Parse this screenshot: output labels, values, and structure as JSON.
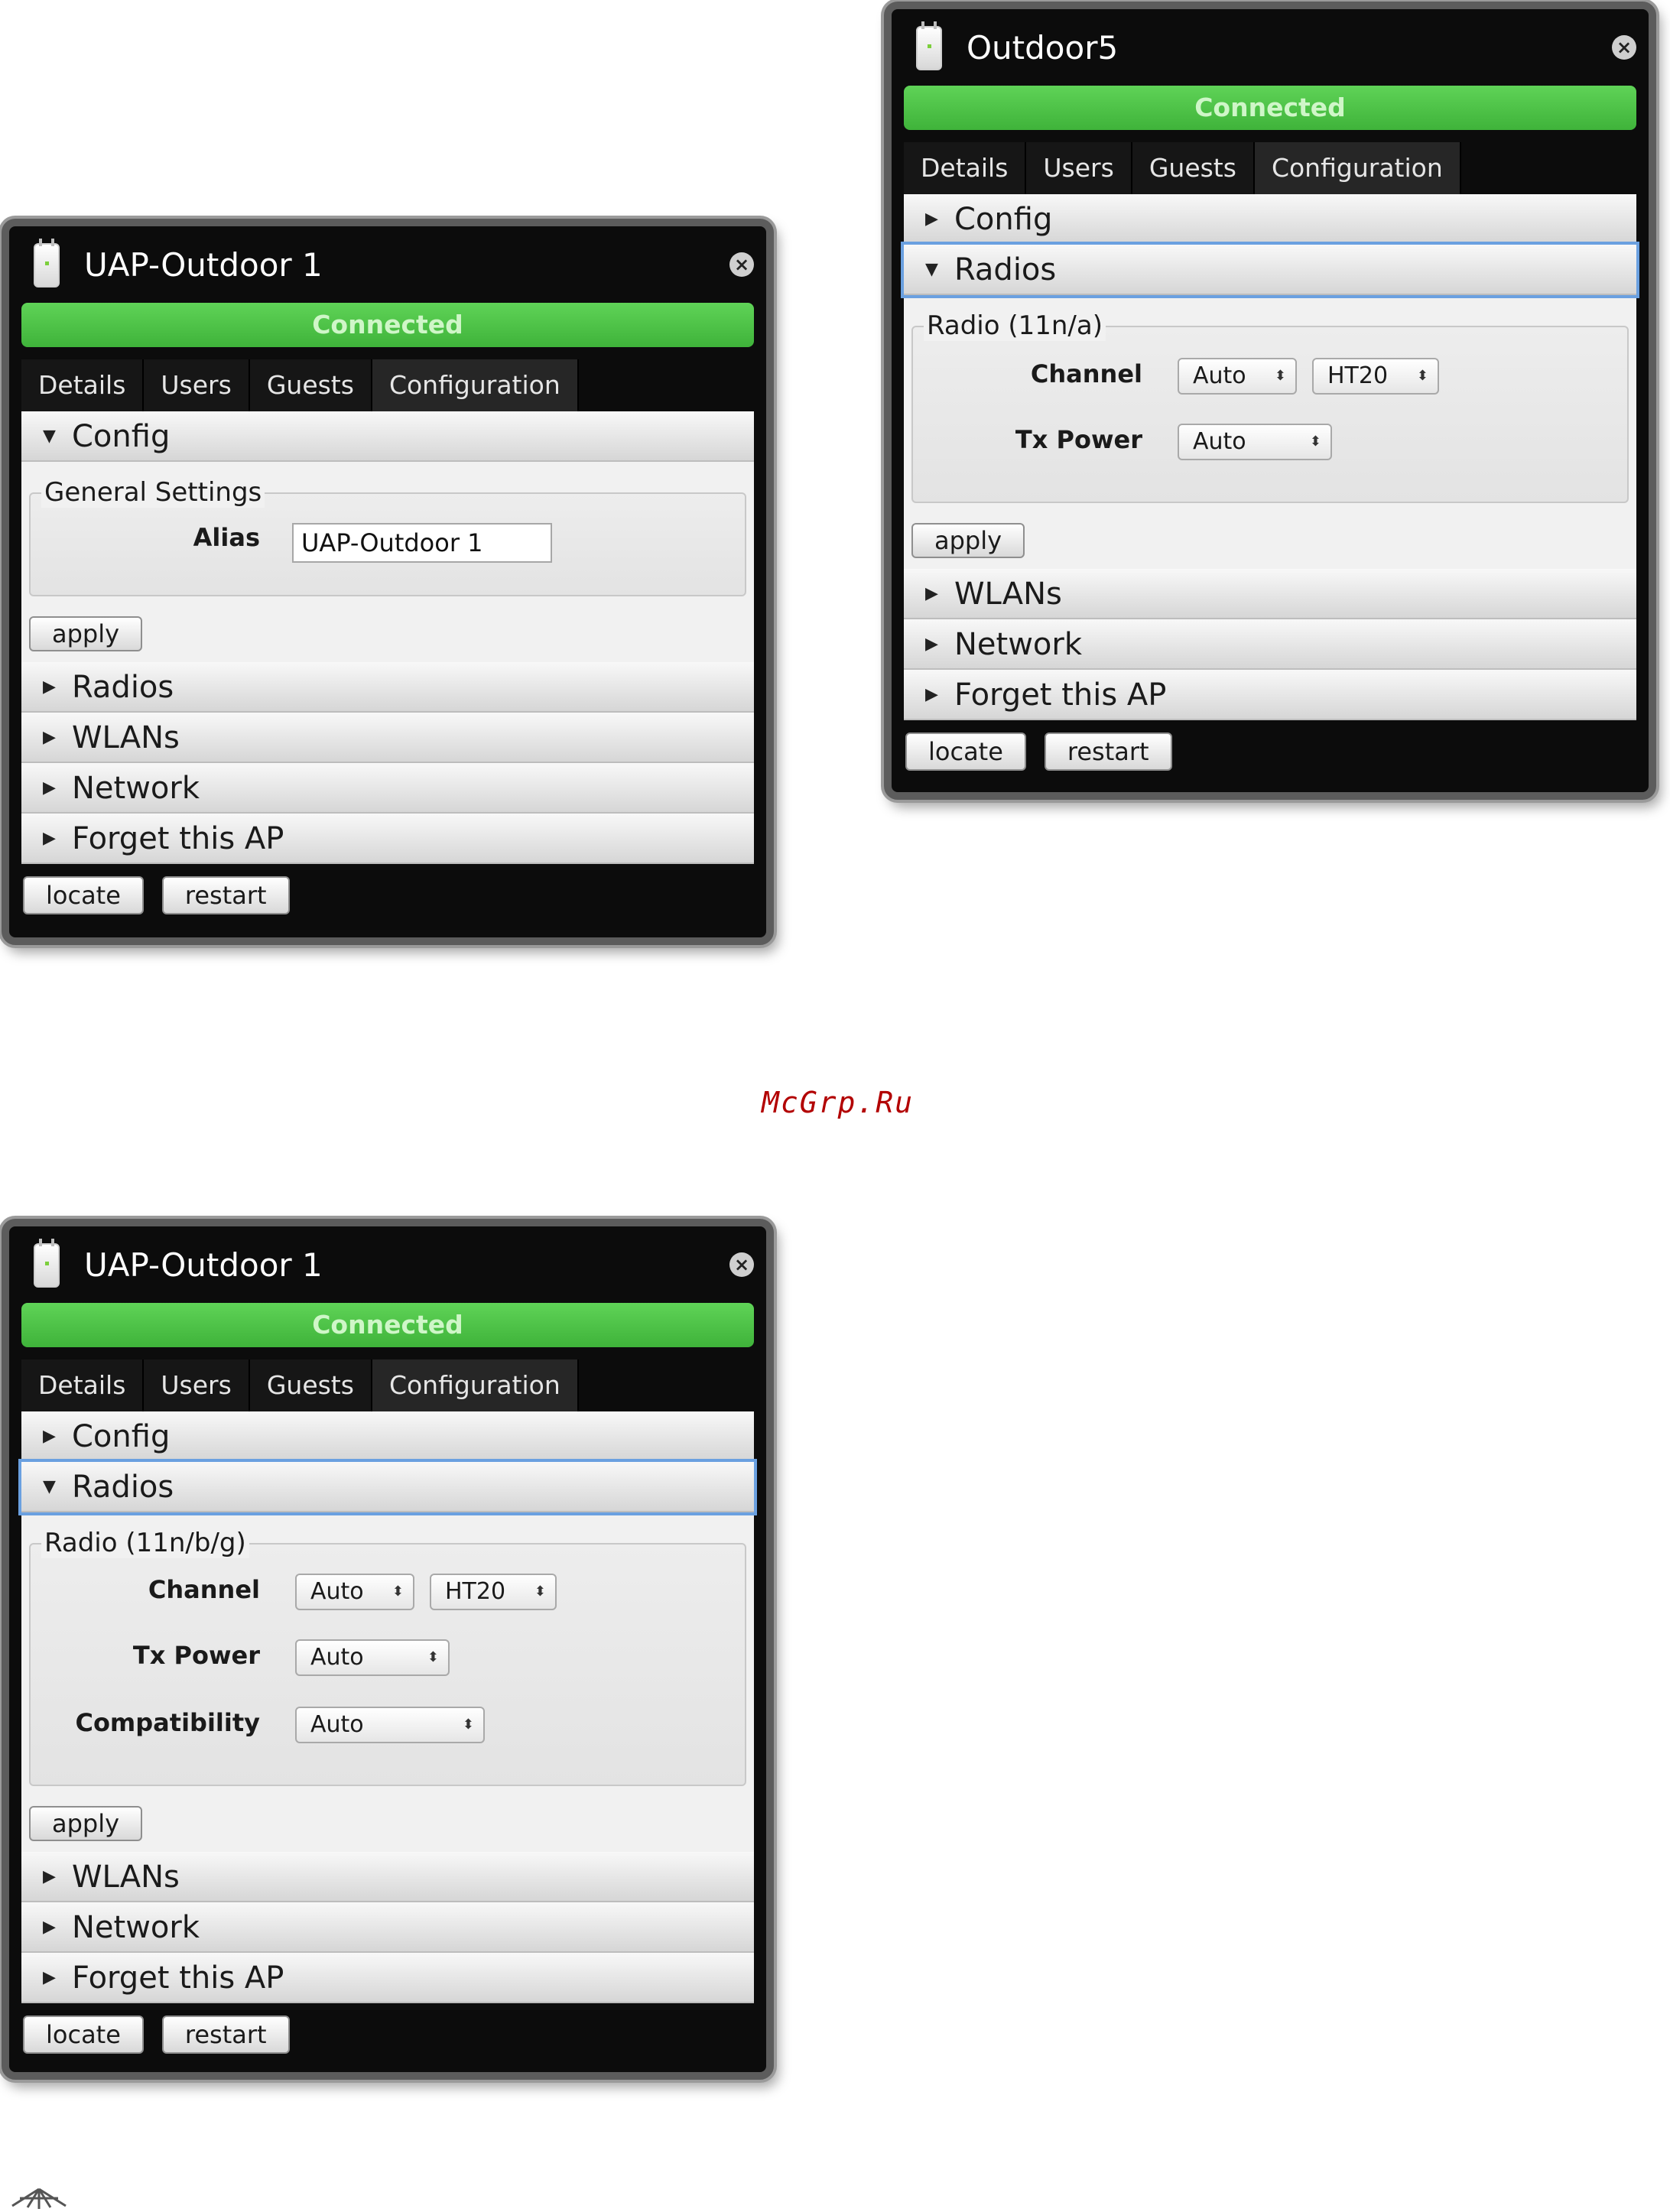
{
  "panels": [
    {
      "title": "UAP-Outdoor 1",
      "status": "Connected",
      "tabs": [
        "Details",
        "Users",
        "Guests",
        "Configuration"
      ],
      "config_section": {
        "label": "Config",
        "group_legend": "General Settings",
        "alias_label": "Alias",
        "alias_value": "UAP-Outdoor 1",
        "apply_label": "apply"
      },
      "collapsed_sections": [
        "Radios",
        "WLANs",
        "Network",
        "Forget this AP"
      ],
      "footer": {
        "locate": "locate",
        "restart": "restart"
      }
    },
    {
      "title": "Outdoor5",
      "status": "Connected",
      "tabs": [
        "Details",
        "Users",
        "Guests",
        "Configuration"
      ],
      "collapsed_top": "Config",
      "radios_section": {
        "label": "Radios",
        "group_legend": "Radio (11n/a)",
        "channel_label": "Channel",
        "channel_value": "Auto",
        "ht_value": "HT20",
        "txpower_label": "Tx Power",
        "txpower_value": "Auto",
        "apply_label": "apply"
      },
      "collapsed_sections": [
        "WLANs",
        "Network",
        "Forget this AP"
      ],
      "footer": {
        "locate": "locate",
        "restart": "restart"
      }
    },
    {
      "title": "UAP-Outdoor 1",
      "status": "Connected",
      "tabs": [
        "Details",
        "Users",
        "Guests",
        "Configuration"
      ],
      "collapsed_top": "Config",
      "radios_section": {
        "label": "Radios",
        "group_legend": "Radio (11n/b/g)",
        "channel_label": "Channel",
        "channel_value": "Auto",
        "ht_value": "HT20",
        "txpower_label": "Tx Power",
        "txpower_value": "Auto",
        "compat_label": "Compatibility",
        "compat_value": "Auto",
        "apply_label": "apply"
      },
      "collapsed_sections": [
        "WLANs",
        "Network",
        "Forget this AP"
      ],
      "footer": {
        "locate": "locate",
        "restart": "restart"
      }
    }
  ],
  "watermark": "McGrp.Ru",
  "colors": {
    "connected": "#46b83f",
    "panel_bg": "#0c0c0c",
    "focus_ring": "#6aa0e0"
  }
}
